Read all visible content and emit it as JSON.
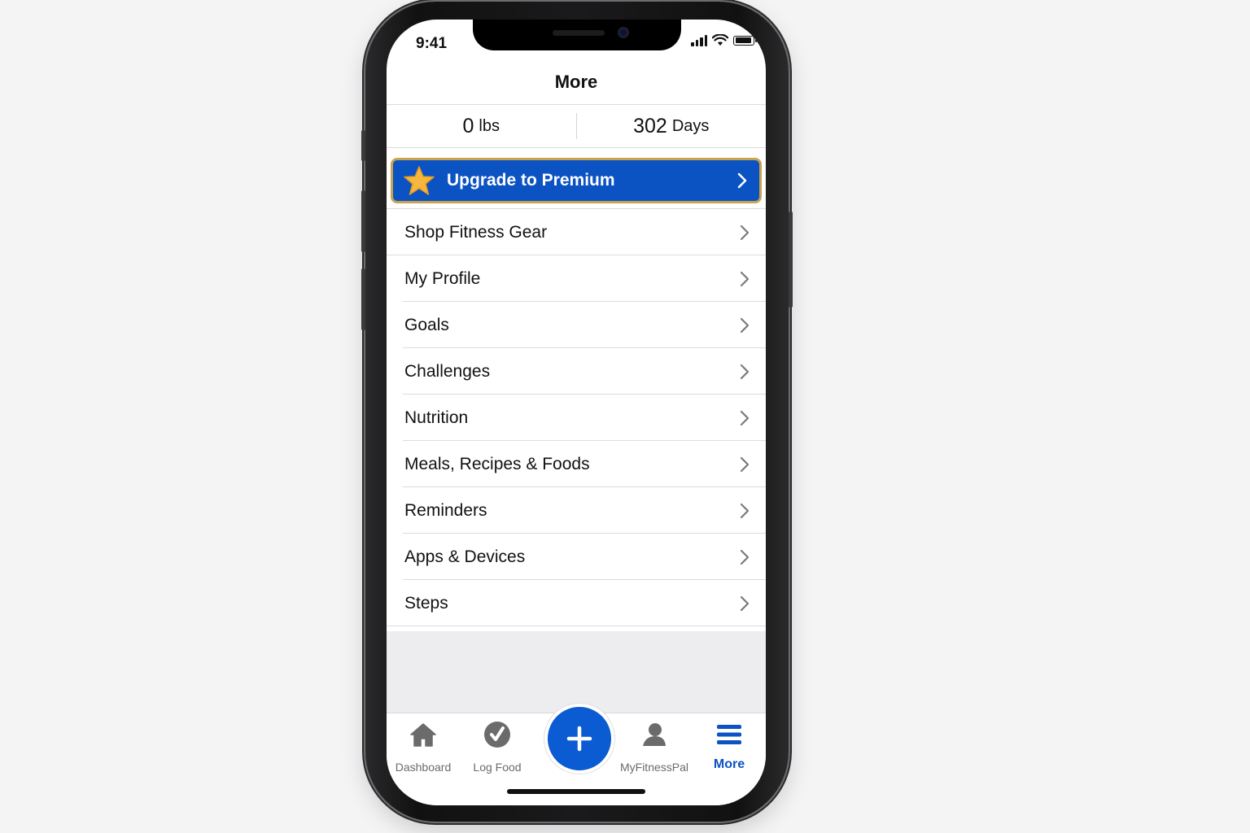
{
  "status_bar": {
    "time": "9:41"
  },
  "header": {
    "title": "More"
  },
  "stats": {
    "weight_value": "0",
    "weight_unit": "lbs",
    "days_value": "302",
    "days_unit": "Days"
  },
  "premium": {
    "label": "Upgrade to Premium",
    "icon": "star-icon",
    "accent": "#0b52c2",
    "border": "#c8a24e"
  },
  "menu": {
    "items": [
      {
        "label": "Shop Fitness Gear"
      },
      {
        "label": "My Profile"
      },
      {
        "label": "Goals"
      },
      {
        "label": "Challenges"
      },
      {
        "label": "Nutrition"
      },
      {
        "label": "Meals, Recipes & Foods"
      },
      {
        "label": "Reminders"
      },
      {
        "label": "Apps & Devices"
      },
      {
        "label": "Steps"
      }
    ]
  },
  "tabbar": {
    "dashboard": "Dashboard",
    "log_food": "Log Food",
    "add": "plus-icon",
    "community": "MyFitnessPal",
    "more": "More",
    "active_color": "#0b52c2"
  }
}
